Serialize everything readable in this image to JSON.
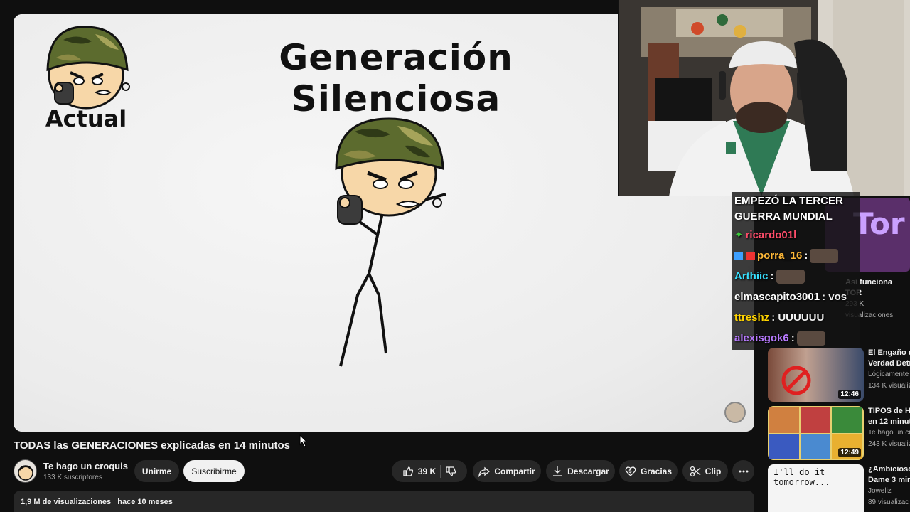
{
  "video": {
    "overlay_title": "Generación Silenciosa",
    "overlay_label": "Actual",
    "title": "TODAS las GENERACIONES explicadas en 14 minutos",
    "views": "1,9 M de visualizaciones",
    "age": "hace 10 meses"
  },
  "channel": {
    "name": "Te hago un croquis",
    "subscribers": "133 K suscriptores"
  },
  "actions": {
    "join": "Unirme",
    "subscribe": "Suscribirme",
    "likes": "39 K",
    "share": "Compartir",
    "download": "Descargar",
    "thanks": "Gracias",
    "clip": "Clip"
  },
  "chat": {
    "header": "EMPEZÓ LA TERCER GUERRA MUNDIAL",
    "messages": [
      {
        "user": "ricardo01l",
        "text": ""
      },
      {
        "user": "porra_16",
        "text": ":"
      },
      {
        "user": "Arthiic",
        "text": ":"
      },
      {
        "user": "elmascapito3001",
        "text": ": vos"
      },
      {
        "user": "ttreshz",
        "text": ": UUUUUU"
      },
      {
        "user": "alexisgok6",
        "text": ":"
      }
    ]
  },
  "recommendations": [
    {
      "title": "Así funciona",
      "line2": "TOR",
      "views": "293 K",
      "views2": "visualizaciones",
      "thumb_text": "Tor"
    },
    {
      "title": "El Engaño d",
      "line2": "Verdad Detr",
      "channel": "Lógicamente",
      "views": "134 K visualiz",
      "duration": "12:46"
    },
    {
      "title": "TIPOS de H",
      "line2": "en 12 minut",
      "channel": "Te hago un cro",
      "views": "243 K visualiz",
      "duration": "12:49"
    },
    {
      "title": "¿Ambicioso",
      "line2": "Dame 3 min",
      "channel": "Joweliz",
      "views": "89 visualizac",
      "thumb_text": "I'll do it tomorrow..."
    }
  ],
  "colors": {
    "background": "#0f0f0f",
    "button_dark": "#272727",
    "subscribe_bg": "#f1f1f1"
  }
}
